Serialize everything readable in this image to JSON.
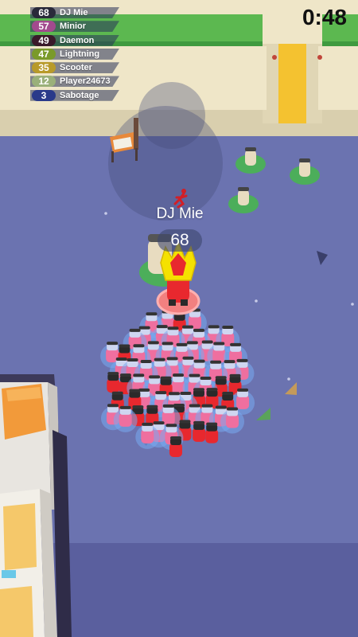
{
  "leaderboard": [
    {
      "count": "68",
      "name": "DJ Mie",
      "color": "#2a2a3a"
    },
    {
      "count": "57",
      "name": "Minior",
      "color": "#a24a8e"
    },
    {
      "count": "49",
      "name": "Daemon",
      "color": "#3a1a2a"
    },
    {
      "count": "47",
      "name": "Lightning",
      "color": "#7a9a2a"
    },
    {
      "count": "35",
      "name": "Scooter",
      "color": "#b89a2a"
    },
    {
      "count": "12",
      "name": "Player24673",
      "color": "#9ab07a"
    },
    {
      "count": "3",
      "name": "Sabotage",
      "color": "#2a3a8a"
    }
  ],
  "timer": "0:48",
  "player": {
    "name": "DJ Mie",
    "count": "68"
  },
  "colors": {
    "floor": "#6b73b0",
    "wall": "#efe6c8",
    "hedge": "#5cb850",
    "path": "#f4c230",
    "crowd_red": "#e8282e",
    "crowd_pink": "#ef6f9f"
  },
  "icons": {
    "crown": "crown-icon",
    "run": "running-figure-icon"
  }
}
